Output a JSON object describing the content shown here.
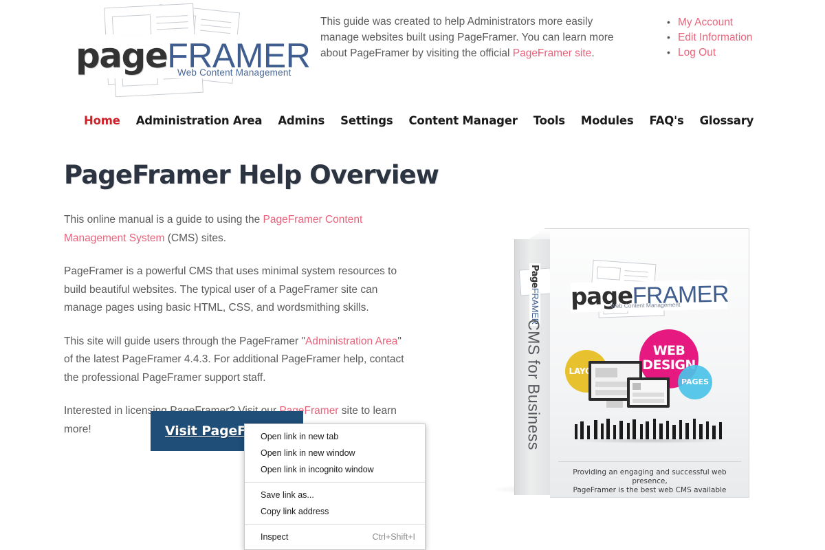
{
  "header": {
    "logo": {
      "word_primary": "page",
      "word_secondary": "FRAMER",
      "tagline": "Web Content Management"
    },
    "blurb": "This guide was created to help Administrators more easily manage websites built using PageFramer. You can learn more about PageFramer by visiting the official PageFramer site.",
    "account_links": [
      {
        "label": "My Account"
      },
      {
        "label": "Edit Information"
      },
      {
        "label": "Log Out"
      }
    ]
  },
  "nav": {
    "items": [
      {
        "label": "Home",
        "active": true
      },
      {
        "label": "Administration Area",
        "active": false
      },
      {
        "label": "Admins",
        "active": false
      },
      {
        "label": "Settings",
        "active": false
      },
      {
        "label": "Content Manager",
        "active": false
      },
      {
        "label": "Tools",
        "active": false
      },
      {
        "label": "Modules",
        "active": false
      },
      {
        "label": "FAQ's",
        "active": false
      },
      {
        "label": "Glossary",
        "active": false
      }
    ]
  },
  "main": {
    "title": "PageFramer Help Overview",
    "paragraph1_pre": "This online manual is a guide to using the ",
    "paragraph1_link": "PageFramer Content Management System",
    "paragraph1_post": " (CMS) sites.",
    "paragraph2": "PageFramer is a powerful CMS that uses minimal system resources to build beautiful websites. The typical user of a PageFramer site can manage pages using basic HTML, CSS, and wordsmithing skills.",
    "paragraph3_pre": "This site will guide users through the PageFramer \"",
    "paragraph3_link": "Administration Area",
    "paragraph3_post": "\" of the latest PageFramer 4.4.3. For additional PageFramer help, contact the professional PageFramer support staff.",
    "paragraph4_pre": "Interested in licensing PageFramer? Visit our ",
    "paragraph4_link": "PageFramer",
    "paragraph4_post": " site to learn more!",
    "cta_label": "Visit PageFramer"
  },
  "product_box": {
    "spine_logo_primary": "Page",
    "spine_logo_secondary": "FRAMER",
    "spine_text": "CMS for Business",
    "front_logo_primary": "page",
    "front_logo_secondary": "FRAMER",
    "front_logo_tagline": "Web Content Management",
    "circles": [
      {
        "label": "LAYOUT",
        "color": "#e8c12e"
      },
      {
        "label": "WEB DESIGN",
        "color": "#e5197f"
      },
      {
        "label": "PAGES",
        "color": "#4bc4e8"
      }
    ],
    "footer_line1": "Providing an engaging and successful web presence,",
    "footer_line2": "PageFramer is the best web CMS available"
  },
  "context_menu": {
    "items": [
      {
        "label": "Open link in new tab",
        "shortcut": ""
      },
      {
        "label": "Open link in new window",
        "shortcut": ""
      },
      {
        "label": "Open link in incognito window",
        "shortcut": ""
      },
      {
        "label": "Save link as...",
        "shortcut": ""
      },
      {
        "label": "Copy link address",
        "shortcut": ""
      },
      {
        "label": "Inspect",
        "shortcut": "Ctrl+Shift+I"
      }
    ]
  },
  "colors": {
    "link": "#e8617a",
    "nav_active": "#cc2229",
    "cta_background": "#1f4e79",
    "logo_secondary": "#3f5d8f",
    "title": "#2b3440"
  }
}
